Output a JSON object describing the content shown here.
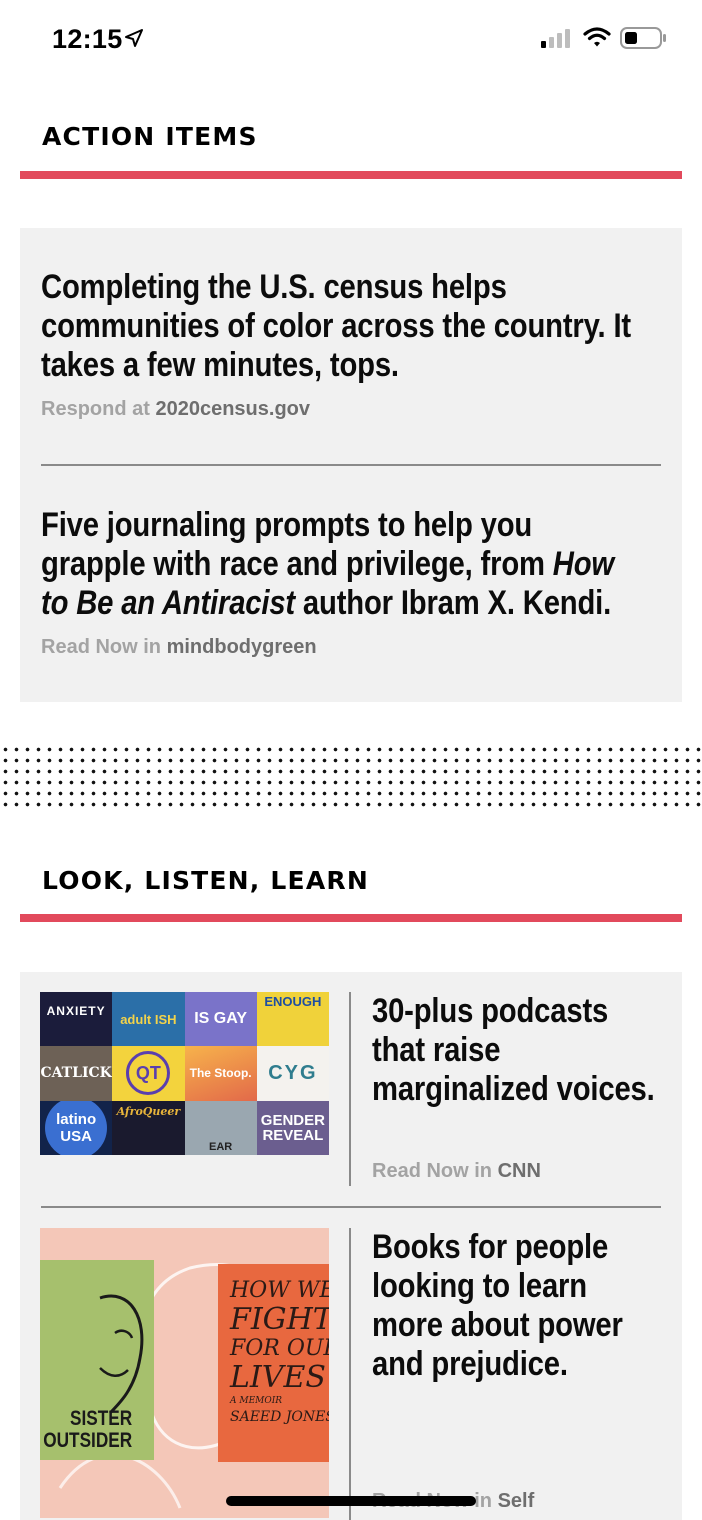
{
  "status_bar": {
    "time": "12:15",
    "icons": [
      "location-arrow-icon",
      "cellular-signal-icon",
      "wifi-icon",
      "battery-icon"
    ]
  },
  "colors": {
    "accent": "#e24a5c",
    "card_bg": "#f1f1f1",
    "muted": "#a3a3a3",
    "source_strong": "#6e6e6e"
  },
  "action_items": {
    "title": "ACTION ITEMS",
    "items": [
      {
        "headline": "Completing the U.S. census helps communities of color across the country. It takes a few minutes, tops.",
        "cta": "Respond at",
        "source": "2020census.gov"
      },
      {
        "headline_lines": [
          "Five journaling prompts to help you",
          "grapple with race and privilege, from ",
          "How",
          "to Be an Antiracist",
          " author Ibram X. Kendi."
        ],
        "cta": "Read Now in",
        "source": "mindbodygreen"
      }
    ]
  },
  "look_listen_learn": {
    "title": "LOOK, LISTEN, LEARN",
    "items": [
      {
        "headline": "30-plus podcasts that raise marginalized voices.",
        "cta": "Read Now in",
        "source": "CNN",
        "image_tiles": [
          "ANXIETY",
          "adult ISH",
          "IS GAY",
          "ENOUGH",
          "CATLICK",
          "QT",
          "QUEER TECH PODCAST",
          "The Stoop.",
          "CYG",
          "latino USA",
          "AfroQueer",
          "EAR",
          "GENDER REVEAL"
        ]
      },
      {
        "headline": "Books for people looking to learn more about power and prejudice.",
        "cta": "Read Now in",
        "source": "Self",
        "image_text": [
          "SISTER",
          "OUTSIDER",
          "HOW WE",
          "FIGHT",
          "FOR OUR",
          "LIVES",
          "A MEMOIR",
          "SAEED JONES"
        ]
      }
    ]
  }
}
